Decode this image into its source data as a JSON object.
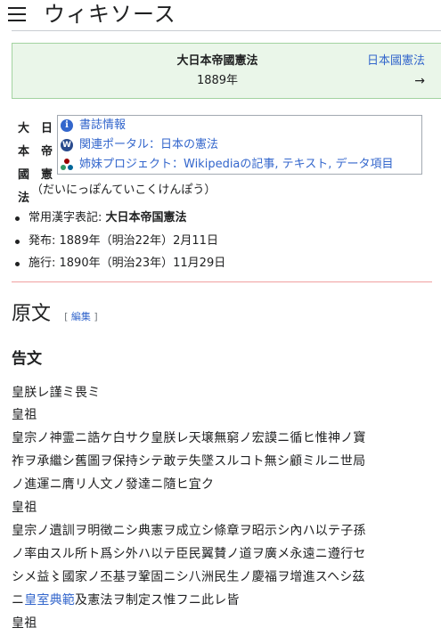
{
  "header": {
    "site_title": "ウィキソース"
  },
  "title_box": {
    "work_title": "大日本帝國憲法",
    "year": "1889年",
    "next_link": "日本國憲法",
    "next_arrow": "→"
  },
  "vertical_title": {
    "col1": [
      "大",
      "本",
      "國",
      "法"
    ],
    "col2": [
      "日",
      "帝",
      "憲"
    ]
  },
  "infobox": {
    "rows": [
      {
        "icon": "info-icon",
        "label": "書誌情報"
      },
      {
        "icon": "portal-icon",
        "label": "関連ポータル：日本の憲法"
      },
      {
        "icon": "wikimedia-sister-icon",
        "label": "姉妹プロジェクト：Wikipediaの記事, テキスト, データ項目"
      }
    ]
  },
  "reading": "（だいにっぽんていこくけんぽう）",
  "bullets": [
    {
      "label": "常用漢字表記: ",
      "value": "大日本帝国憲法"
    },
    {
      "label": "発布: 1889年（明治22年）2月11日",
      "value": ""
    },
    {
      "label": "施行: 1890年（明治23年）11月29日",
      "value": ""
    }
  ],
  "section": {
    "title": "原文",
    "edit_open": "[",
    "edit_label": "編集",
    "edit_close": "]"
  },
  "subheading": "告文",
  "body_lines": [
    "皇朕レ謹ミ畏ミ",
    "皇祖",
    "皇宗ノ神霊ニ誥ケ白サク皇朕レ天壌無窮ノ宏謨ニ循ヒ惟神ノ寶",
    "祚ヲ承繼シ舊圖ヲ保持シテ敢テ失墜スルコト無シ顧ミルニ世局",
    "ノ進運ニ膺リ人文ノ發達ニ隨ヒ宜ク",
    "皇祖",
    "皇宗ノ遺訓ヲ明徴ニシ典憲ヲ成立シ條章ヲ昭示シ內ハ以テ子孫",
    "ノ率由スル所ト爲シ外ハ以テ臣民翼賛ノ道ヲ廣メ永遠ニ遵行セ",
    "シメ益〻國家ノ丕基ヲ鞏固ニシ八洲民生ノ慶福ヲ增進スヘシ茲",
    "皇祖"
  ],
  "body_line_9": {
    "prefix": "ニ",
    "link": "皇室典範",
    "suffix": "及憲法ヲ制定ス惟フニ此レ皆"
  },
  "colors": {
    "link": "#3366cc",
    "title_box_bg": "#eaf6e9",
    "title_box_border": "#a3d3a0"
  }
}
